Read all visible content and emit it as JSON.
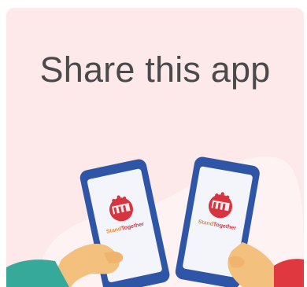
{
  "card": {
    "title": "Share this app",
    "app_brand_prefix": "Stand",
    "app_brand_suffix": "Together",
    "colors": {
      "card_background": "#fde8ea",
      "title_text": "#4a4a4a",
      "phone_frame": "#2f56a6",
      "screen": "#f3f5fa",
      "logo_red": "#d8343f",
      "hand_skin": "#f4c07e",
      "sleeve_left": "#36a99b",
      "sleeve_right": "#e0383f"
    },
    "icons": [
      "phone-icon",
      "app-logo-icon",
      "hand-icon"
    ]
  }
}
